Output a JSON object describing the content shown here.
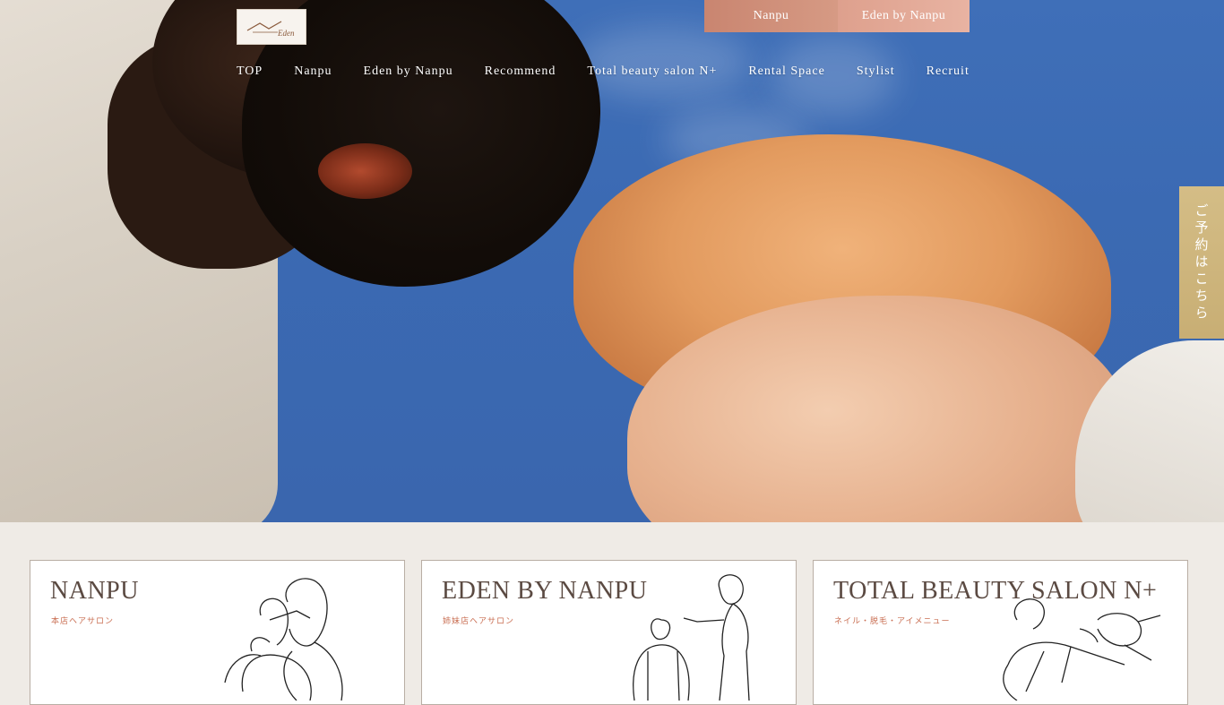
{
  "header": {
    "logo_alt": "Eden",
    "top_tabs": [
      {
        "label": "Nanpu"
      },
      {
        "label": "Eden by Nanpu"
      }
    ],
    "nav": [
      {
        "label": "TOP"
      },
      {
        "label": "Nanpu"
      },
      {
        "label": "Eden by Nanpu"
      },
      {
        "label": "Recommend"
      },
      {
        "label": "Total beauty salon N+"
      },
      {
        "label": "Rental Space"
      },
      {
        "label": "Stylist"
      },
      {
        "label": "Recruit"
      }
    ]
  },
  "reserve_button": {
    "label": "ご予約はこちら"
  },
  "cards": [
    {
      "title": "NANPU",
      "subtitle": "本店ヘアサロン"
    },
    {
      "title": "EDEN BY NANPU",
      "subtitle": "姉妹店ヘアサロン"
    },
    {
      "title": "TOTAL BEAUTY SALON N+",
      "subtitle": "ネイル・脱毛・アイメニュー"
    }
  ],
  "colors": {
    "sky": "#3b6ab3",
    "tab_primary": "#c98570",
    "tab_secondary": "#e8b3a2",
    "reserve_gold": "#d0b77e",
    "card_title": "#5b4a42",
    "card_subtitle": "#c96e52",
    "page_bg": "#efebe6"
  }
}
